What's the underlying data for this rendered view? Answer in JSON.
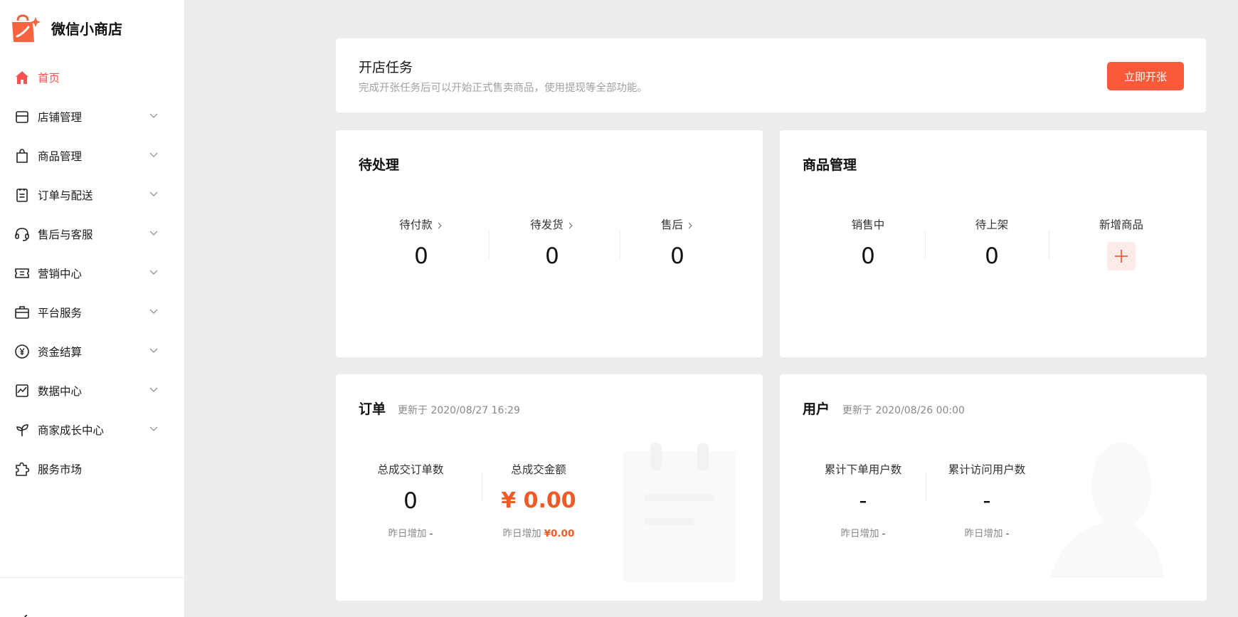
{
  "brand": {
    "name": "微信小商店"
  },
  "colors": {
    "accent": "#fa5151",
    "button": "#fa5a3a",
    "money": "#f05a24",
    "background": "#ededed"
  },
  "sidebar": {
    "items": [
      {
        "label": "首页",
        "icon": "home-icon",
        "active": true
      },
      {
        "label": "店铺管理",
        "icon": "store-icon",
        "active": false
      },
      {
        "label": "商品管理",
        "icon": "shopping-bag-icon",
        "active": false
      },
      {
        "label": "订单与配送",
        "icon": "clipboard-icon",
        "active": false
      },
      {
        "label": "售后与客服",
        "icon": "headset-icon",
        "active": false
      },
      {
        "label": "营销中心",
        "icon": "ticket-icon",
        "active": false
      },
      {
        "label": "平台服务",
        "icon": "briefcase-icon",
        "active": false
      },
      {
        "label": "资金结算",
        "icon": "yuan-coin-icon",
        "active": false
      },
      {
        "label": "数据中心",
        "icon": "chart-icon",
        "active": false
      },
      {
        "label": "商家成长中心",
        "icon": "sprout-icon",
        "active": false
      },
      {
        "label": "服务市场",
        "icon": "puzzle-icon",
        "active": false
      }
    ]
  },
  "task": {
    "title": "开店任务",
    "description": "完成开张任务后可以开始正式售卖商品，使用提现等全部功能。",
    "button": "立即开张"
  },
  "pending": {
    "title": "待处理",
    "items": [
      {
        "label": "待付款",
        "value": "0"
      },
      {
        "label": "待发货",
        "value": "0"
      },
      {
        "label": "售后",
        "value": "0"
      }
    ]
  },
  "goods": {
    "title": "商品管理",
    "items": [
      {
        "label": "销售中",
        "value": "0"
      },
      {
        "label": "待上架",
        "value": "0"
      }
    ],
    "add_label": "新增商品"
  },
  "orders": {
    "title": "订单",
    "updated": "更新于  2020/08/27 16:29",
    "items": [
      {
        "label": "总成交订单数",
        "value": "0",
        "foot_label": "昨日增加",
        "foot_value": "-"
      },
      {
        "label": "总成交金额",
        "value": "¥ 0.00",
        "foot_label": "昨日增加",
        "foot_value": "¥0.00"
      }
    ]
  },
  "users": {
    "title": "用户",
    "updated": "更新于  2020/08/26 00:00",
    "items": [
      {
        "label": "累计下单用户数",
        "value": "-",
        "foot_label": "昨日增加",
        "foot_value": "-"
      },
      {
        "label": "累计访问用户数",
        "value": "-",
        "foot_label": "昨日增加",
        "foot_value": "-"
      }
    ]
  }
}
